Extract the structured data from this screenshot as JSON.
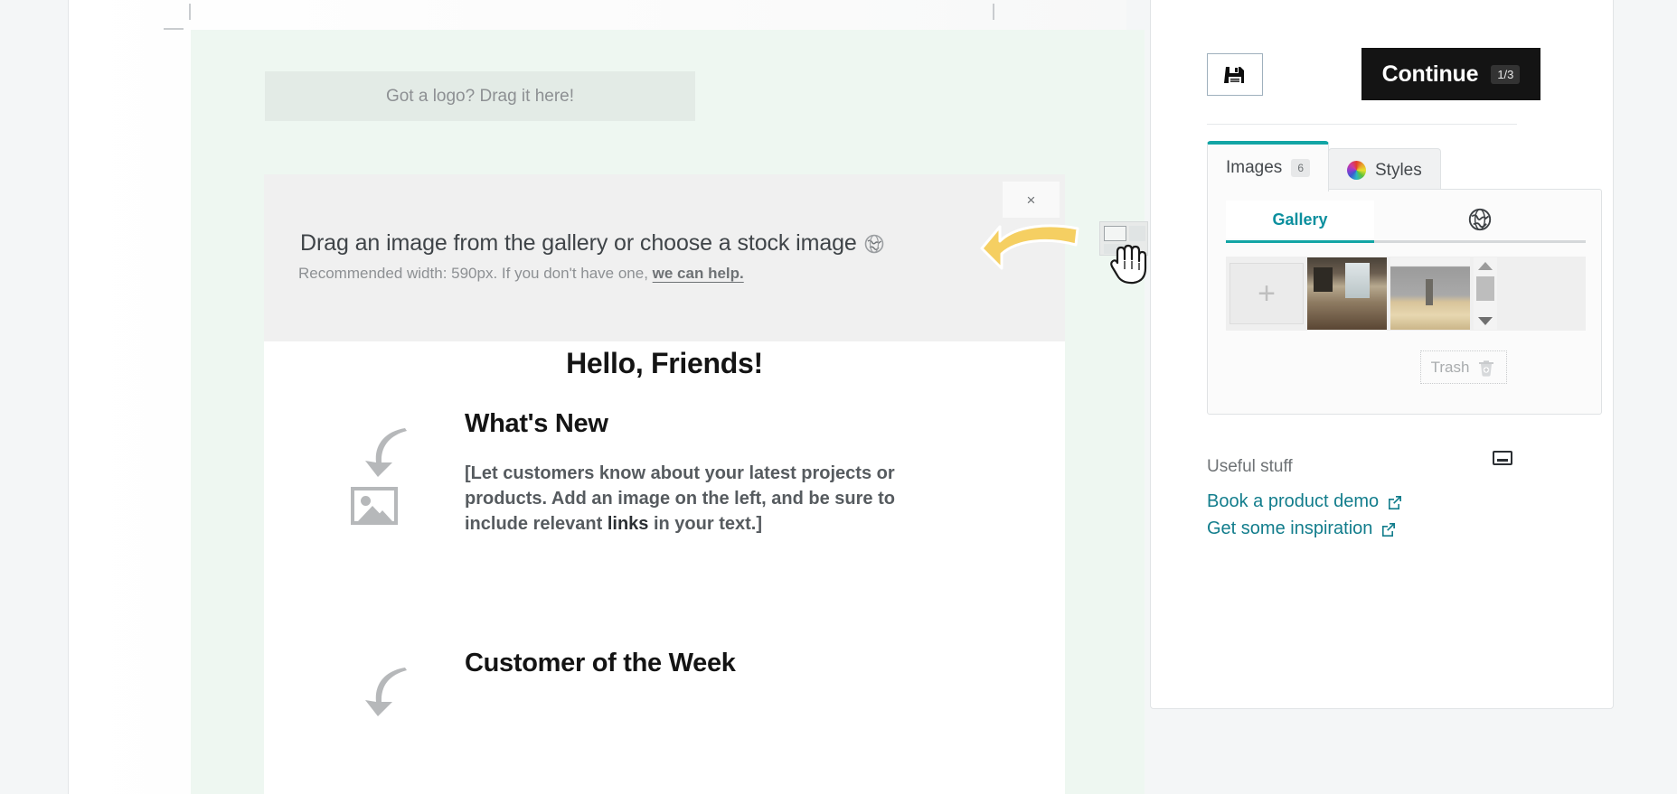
{
  "canvas": {
    "logo_drop": {
      "label": "Got a logo? Drag it here!"
    },
    "image_drop": {
      "title": "Drag an image from the gallery or choose a stock image",
      "title_icon": "globe-icon",
      "subtitle_prefix": "Recommended width: 590px. If you don't have one, ",
      "subtitle_link": "we can help.",
      "close_label": "×"
    },
    "newsletter": {
      "greeting": "Hello, Friends!",
      "section_one_heading": "What's New",
      "body_part_one": "[Let customers know about your latest projects or products. Add an image on the left, and be sure to include relevant ",
      "body_link_word": "links",
      "body_part_two": " in your text.]",
      "section_two_heading": "Customer of the Week"
    },
    "drag_ghost_icon": "image-thumbnail-drag-icon",
    "cursor_icon": "grabbing-hand-cursor",
    "pointer_icon": "yellow-curved-arrow-icon"
  },
  "panel": {
    "save_icon": "floppy-disk-save-icon",
    "continue": {
      "label": "Continue",
      "step": "1/3"
    },
    "tabs": [
      {
        "label": "Images",
        "badge": "6",
        "active": true,
        "icon": null
      },
      {
        "label": "Styles",
        "badge": null,
        "active": false,
        "icon": "color-wheel-icon"
      }
    ],
    "images_pane": {
      "subtabs": [
        {
          "label": "Gallery",
          "active": true
        },
        {
          "label": "",
          "icon": "globe-icon",
          "active": false
        }
      ],
      "add_button_glyph": "+",
      "thumbnails": [
        "add-image-tile",
        "cafe-interior-thumbnail",
        "open-book-thumbnail"
      ],
      "scrollbar": {
        "up_icon": "scroll-up-arrow-icon",
        "down_icon": "scroll-down-arrow-icon"
      },
      "trash": {
        "label": "Trash",
        "icon": "trash-can-icon"
      }
    },
    "useful": {
      "heading": "Useful stuff",
      "collapse_icon": "collapse-icon",
      "links": [
        {
          "label": "Book a product demo",
          "icon": "external-link-icon"
        },
        {
          "label": "Get some inspiration",
          "icon": "external-link-icon"
        }
      ]
    }
  },
  "colors": {
    "accent_teal": "#12a5a5",
    "link_teal": "#127d8c",
    "continue_bg": "#141414",
    "email_bg": "#eef7f1",
    "drop_bg": "#f0f0f0",
    "logo_drop_bg": "#e3ebe6",
    "arrow_yellow": "#f5cf62"
  }
}
